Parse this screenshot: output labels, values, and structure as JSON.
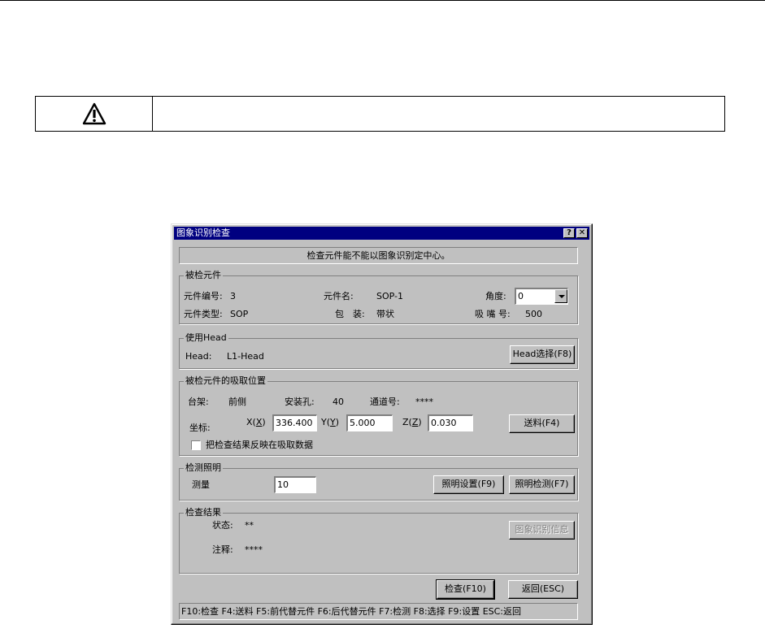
{
  "dialog": {
    "title": "图象识别检查",
    "help_button": "?",
    "close_button": "✕",
    "message": "检查元件能不能以图象识别定中心。"
  },
  "component": {
    "legend": "被检元件",
    "number_label": "元件编号:",
    "number_value": "3",
    "name_label": "元件名:",
    "name_value": "SOP-1",
    "angle_label": "角度:",
    "angle_value": "0",
    "type_label": "元件类型:",
    "type_value": "SOP",
    "package_label": "包　装:",
    "package_value": "带状",
    "nozzle_label": "吸 嘴 号:",
    "nozzle_value": "500"
  },
  "head": {
    "legend": "使用Head",
    "head_label": "Head:",
    "head_value": "L1-Head",
    "select_button": "Head选择(F8)"
  },
  "pickup": {
    "legend": "被检元件的吸取位置",
    "rack_label": "台架:",
    "rack_value": "前侧",
    "hole_label": "安装孔:",
    "hole_value": "40",
    "channel_label": "通道号:",
    "channel_value": "****",
    "coord_label": "坐标:",
    "x_label": "X",
    "x_key": "X",
    "x_value": "336.400",
    "y_label": "Y",
    "y_key": "Y",
    "y_value": "5.000",
    "z_label": "Z",
    "z_key": "Z",
    "z_value": "0.030",
    "feed_button": "送料(F4)",
    "reflect_checkbox_label": "把检查结果反映在吸取数据",
    "reflect_checked": false
  },
  "lighting": {
    "legend": "检测照明",
    "measure_label": "测量",
    "measure_value": "10",
    "settings_button": "照明设置(F9)",
    "test_button": "照明检测(F7)"
  },
  "result": {
    "legend": "检查结果",
    "status_label": "状态:",
    "status_value": "**",
    "note_label": "注释:",
    "note_value": "****",
    "info_button": "图象识别信息"
  },
  "actions": {
    "check_button": "检查(F10)",
    "back_button": "返回(ESC)"
  },
  "status_bar": "F10:检查 F4:送料 F5:前代替元件 F6:后代替元件 F7:检测 F8:选择 F9:设置 ESC:返回"
}
